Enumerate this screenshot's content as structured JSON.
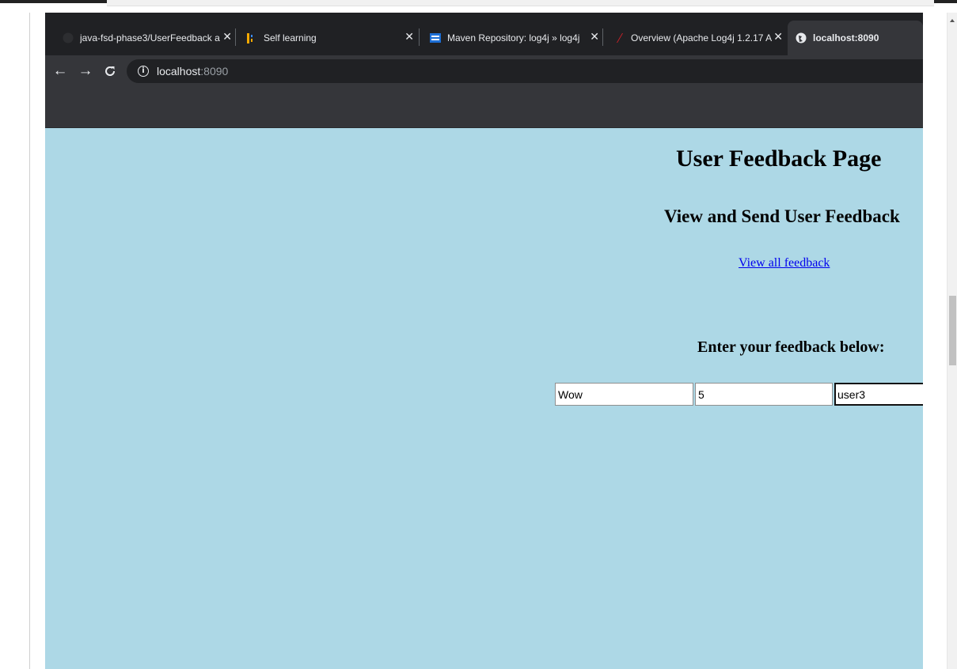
{
  "browser": {
    "tabs": [
      {
        "label": "java-fsd-phase3/UserFeedback a",
        "icon": "github-icon",
        "active": false
      },
      {
        "label": "Self learning",
        "icon": "bars-logo-icon",
        "active": false
      },
      {
        "label": "Maven Repository: log4j » log4j",
        "icon": "maven-icon",
        "active": false
      },
      {
        "label": "Overview (Apache Log4j 1.2.17 A",
        "icon": "apache-feather-icon",
        "active": false
      },
      {
        "label": "localhost:8090",
        "icon": "globe-icon",
        "active": true
      }
    ],
    "address": {
      "host": "localhost",
      "port": ":8090"
    }
  },
  "page": {
    "title": "User Feedback Page",
    "subtitle": "View and Send User Feedback",
    "view_all_link": "View all feedback",
    "form_heading": "Enter your feedback below:",
    "fields": [
      {
        "value": "Wow"
      },
      {
        "value": "5"
      },
      {
        "value": "user3"
      }
    ]
  },
  "colors": {
    "page_background": "#add8e6",
    "link": "#0000ee",
    "tab_strip": "#202124",
    "toolbar": "#35363a"
  }
}
